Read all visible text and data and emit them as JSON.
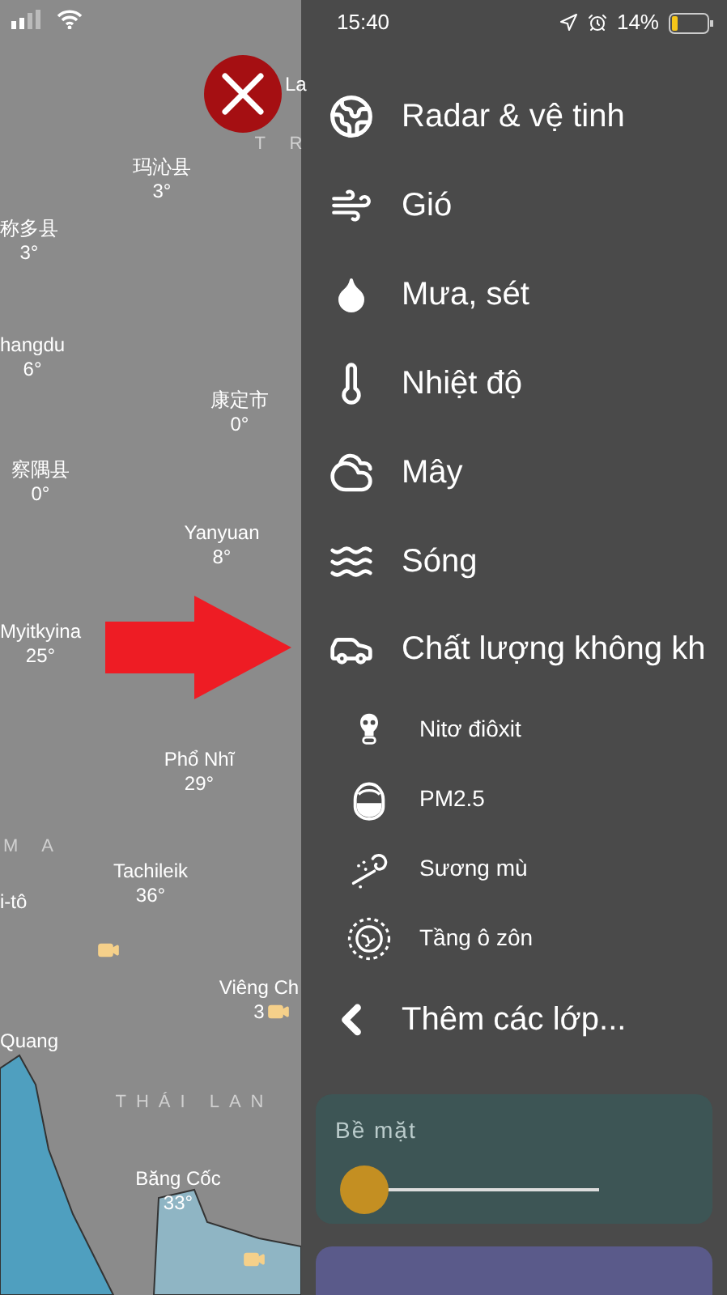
{
  "status_bar": {
    "time": "15:40",
    "battery": "14%"
  },
  "map": {
    "labels": [
      {
        "name": "玛沁县",
        "temp": "3°"
      },
      {
        "name": "称多县",
        "temp": "3°"
      },
      {
        "name": "hangdu",
        "temp": "6°"
      },
      {
        "name": "康定市",
        "temp": "0°"
      },
      {
        "name": "察隅县",
        "temp": "0°"
      },
      {
        "name": "Yanyuan",
        "temp": "8°"
      },
      {
        "name": "Myitkyina",
        "temp": "25°"
      },
      {
        "name": "Phổ Nhĩ",
        "temp": "29°"
      },
      {
        "name": "Tachileik",
        "temp": "36°"
      },
      {
        "name": "Viêng Ch",
        "temp": "3"
      },
      {
        "name": "Băng Cốc",
        "temp": "33°"
      },
      {
        "name": "i-tô"
      },
      {
        "name": "Quang"
      },
      {
        "name": "La"
      }
    ],
    "regions": [
      "T R",
      "M A",
      "THÁI LAN"
    ]
  },
  "menu": {
    "items": [
      {
        "kind": "main",
        "label": "Radar & vệ tinh"
      },
      {
        "kind": "main",
        "label": "Gió"
      },
      {
        "kind": "main",
        "label": "Mưa, sét"
      },
      {
        "kind": "main",
        "label": "Nhiệt độ"
      },
      {
        "kind": "main",
        "label": "Mây"
      },
      {
        "kind": "main",
        "label": "Sóng"
      },
      {
        "kind": "main",
        "label": "Chất lượng không kh"
      },
      {
        "kind": "sub",
        "label": "Nitơ điôxit"
      },
      {
        "kind": "sub",
        "label": "PM2.5"
      },
      {
        "kind": "sub",
        "label": "Sương mù"
      },
      {
        "kind": "sub",
        "label": "Tầng ô zôn"
      },
      {
        "kind": "more",
        "label": "Thêm các lớp..."
      }
    ]
  },
  "altitude": {
    "label": "Bề mặt",
    "level": 0
  }
}
